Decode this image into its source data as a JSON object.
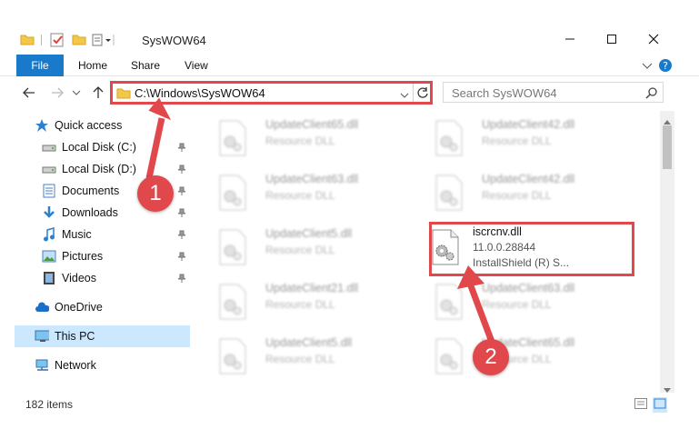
{
  "window": {
    "title": "SysWOW64",
    "controls": [
      "minimize-icon",
      "maximize-icon",
      "close-icon"
    ]
  },
  "ribbon": {
    "tabs": [
      {
        "label": "File",
        "active": true
      },
      {
        "label": "Home"
      },
      {
        "label": "Share"
      },
      {
        "label": "View"
      }
    ]
  },
  "address": {
    "path": "C:\\Windows\\SysWOW64",
    "search_placeholder": "Search SysWOW64"
  },
  "nav_pane": {
    "items": [
      {
        "label": "Quick access",
        "icon": "star-icon"
      },
      {
        "label": "Local Disk (C:)",
        "icon": "drive-icon",
        "pinned": true
      },
      {
        "label": "Local Disk (D:)",
        "icon": "drive-icon",
        "pinned": true
      },
      {
        "label": "Documents",
        "icon": "documents-icon",
        "pinned": true
      },
      {
        "label": "Downloads",
        "icon": "downloads-icon",
        "pinned": true
      },
      {
        "label": "Music",
        "icon": "music-icon",
        "pinned": true
      },
      {
        "label": "Pictures",
        "icon": "pictures-icon",
        "pinned": true
      },
      {
        "label": "Videos",
        "icon": "videos-icon",
        "pinned": true
      },
      {
        "label": "OneDrive",
        "icon": "cloud-icon"
      },
      {
        "label": "This PC",
        "icon": "computer-icon",
        "selected": true
      },
      {
        "label": "Network",
        "icon": "network-icon"
      }
    ]
  },
  "files": {
    "left": [
      {
        "name": "UpdateClient65.dll",
        "type": "Resource DLL"
      },
      {
        "name": "UpdateClient63.dll",
        "type": "Resource DLL"
      },
      {
        "name": "UpdateClient5.dll",
        "type": "Resource DLL"
      },
      {
        "name": "UpdateClient21.dll",
        "type": "Resource DLL"
      },
      {
        "name": "UpdateClient5.dll",
        "type": "Resource DLL"
      }
    ],
    "right": [
      {
        "name": "UpdateClient42.dll",
        "type": "Resource DLL"
      },
      {
        "name": "UpdateClient42.dll",
        "type": "Resource DLL"
      },
      {
        "name": "iscrcnv.dll",
        "type": "11.0.0.28844",
        "desc": "InstallShield (R) S...",
        "highlighted": true
      },
      {
        "name": "UpdateClient63.dll",
        "type": "Resource DLL"
      },
      {
        "name": "UpdateClient65.dll",
        "type": "Resource DLL"
      }
    ]
  },
  "status": {
    "item_count": "182 items"
  },
  "annotations": {
    "step1": "1",
    "step2": "2"
  },
  "colors": {
    "accent": "#1979ca",
    "highlight": "#e0484b",
    "selection": "#cce8ff"
  }
}
